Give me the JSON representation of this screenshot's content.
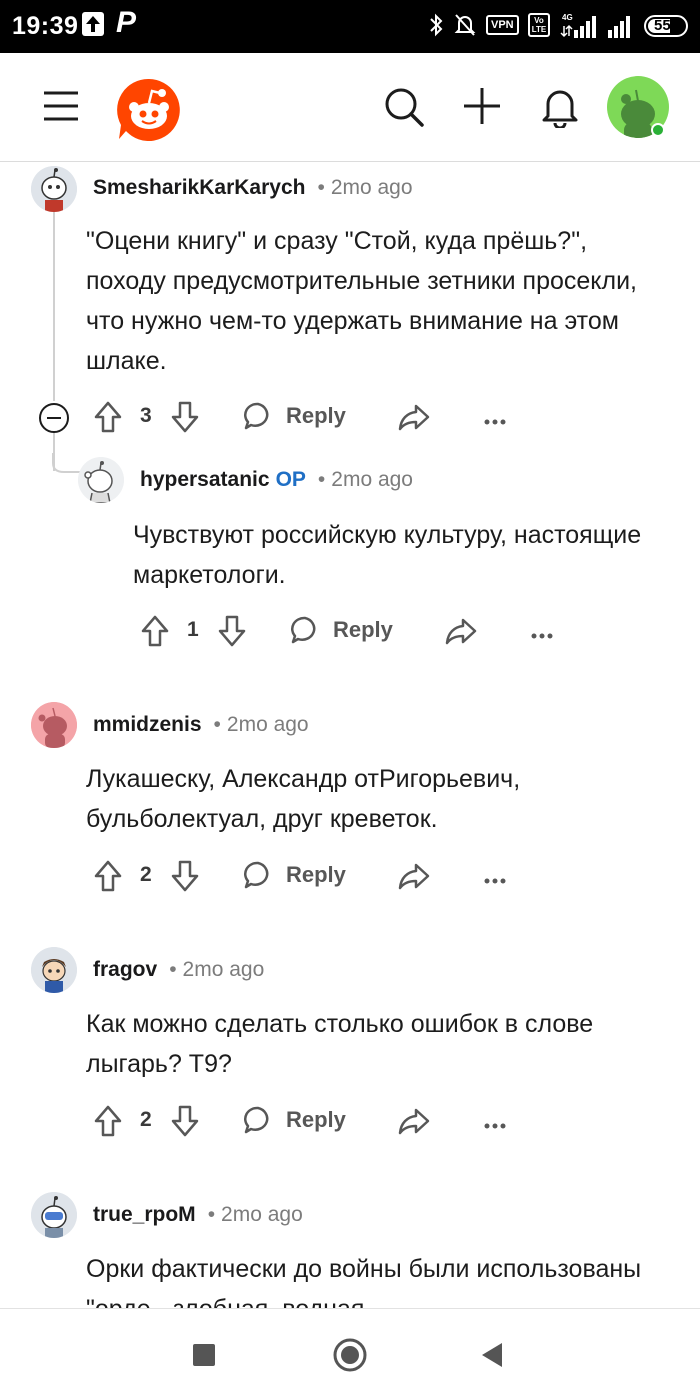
{
  "status_bar": {
    "time": "19:39",
    "network_badge": "VPN",
    "volte_badge": "Vo LTE",
    "network_type": "4G",
    "battery_level": "55",
    "icons": [
      "upload-icon",
      "pcz-app-icon",
      "bluetooth-icon",
      "alarm-off-icon",
      "signal-icon",
      "signal-icon",
      "battery-icon"
    ]
  },
  "header": {
    "icons": [
      "menu-icon",
      "reddit-logo-icon",
      "search-icon",
      "plus-icon",
      "bell-icon",
      "user-avatar-icon"
    ],
    "accent": "#ff4500",
    "avatar_bg": "#7ed957"
  },
  "comments": [
    {
      "user": "SmesharikKarKarych",
      "op": "",
      "time": "2mo ago",
      "body": "\"Оцени книгу\" и сразу \"Стой, куда прёшь?\", походу предусмотрительные зетники просекли, что нужно чем-то удержать внимание на этом шлаке.",
      "score": "3",
      "reply": "Reply"
    },
    {
      "user": "hypersatanic",
      "op": "OP",
      "time": "2mo ago",
      "body": "Чувствуют российскую культуру, настоящие маркетологи.",
      "score": "1",
      "reply": "Reply"
    },
    {
      "user": "mmidzenis",
      "op": "",
      "time": "2mo ago",
      "body": "Лукашеску, Александр отРигорьевич, бульболектуал, друг креветок.",
      "score": "2",
      "reply": "Reply"
    },
    {
      "user": "fragov",
      "op": "",
      "time": "2mo ago",
      "body": "Как можно сделать столько ошибок в слове лыгарь? Т9?",
      "score": "2",
      "reply": "Reply"
    },
    {
      "user": "true_rpoM",
      "op": "",
      "time": "2mo ago",
      "body": "Орки фактически до войны были использованы \"орде - злобная, водная",
      "score": "",
      "reply": ""
    }
  ],
  "bottom_nav": {
    "icons": [
      "recents-square-icon",
      "home-circle-icon",
      "back-triangle-icon"
    ]
  }
}
